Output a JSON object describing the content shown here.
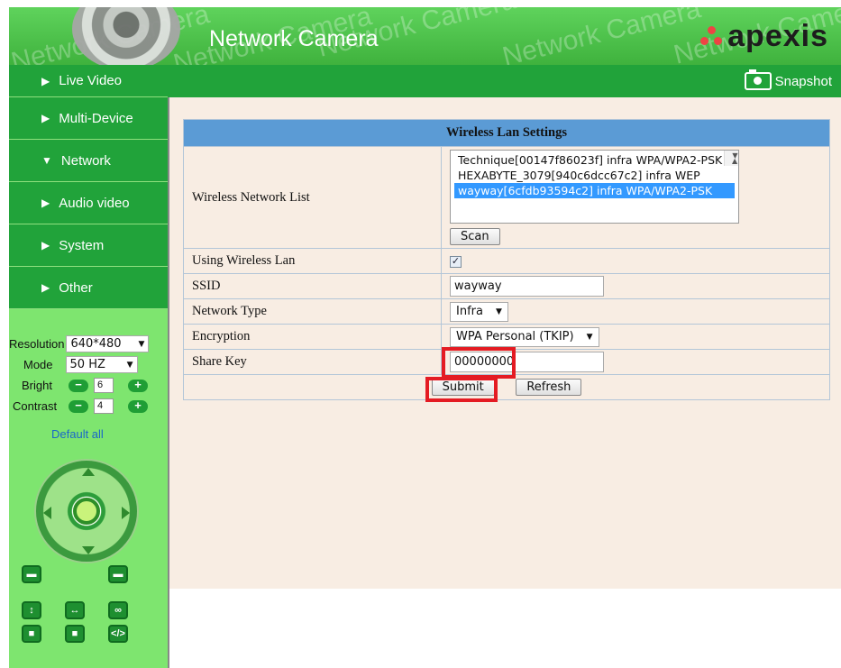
{
  "header": {
    "title": "Network Camera",
    "brand": "apexis",
    "watermark": "Network Camera"
  },
  "toolbar": {
    "snapshot_label": "Snapshot"
  },
  "sidebar": {
    "items": [
      {
        "label": "Live Video",
        "expanded": false
      },
      {
        "label": "Multi-Device",
        "expanded": false
      },
      {
        "label": "Network",
        "expanded": true
      },
      {
        "label": "Audio video",
        "expanded": false
      },
      {
        "label": "System",
        "expanded": false
      },
      {
        "label": "Other",
        "expanded": false
      }
    ],
    "controls": {
      "resolution_label": "Resolution",
      "resolution_value": "640*480",
      "mode_label": "Mode",
      "mode_value": "50 HZ",
      "bright_label": "Bright",
      "bright_value": "6",
      "contrast_label": "Contrast",
      "contrast_value": "4",
      "default_all": "Default all",
      "minus": "−",
      "plus": "+"
    },
    "icon_buttons": [
      {
        "glyph": "▬"
      },
      {
        "glyph": "▬"
      },
      {
        "glyph": "↕"
      },
      {
        "glyph": "↔"
      },
      {
        "glyph": "∞"
      },
      {
        "glyph": "■"
      },
      {
        "glyph": "■"
      },
      {
        "glyph": "</>"
      }
    ]
  },
  "wireless": {
    "title": "Wireless Lan Settings",
    "network_list_label": "Wireless Network List",
    "networks": [
      "Technique[00147f86023f] infra WPA/WPA2-PSK",
      "HEXABYTE_3079[940c6dcc67c2] infra WEP",
      "wayway[6cfdb93594c2] infra WPA/WPA2-PSK"
    ],
    "selected_network_index": 2,
    "scan_label": "Scan",
    "using_wireless_label": "Using Wireless Lan",
    "using_wireless_checked": true,
    "ssid_label": "SSID",
    "ssid_value": "wayway",
    "network_type_label": "Network Type",
    "network_type_value": "Infra",
    "encryption_label": "Encryption",
    "encryption_value": "WPA Personal (TKIP)",
    "share_key_label": "Share Key",
    "share_key_value": "00000000",
    "submit_label": "Submit",
    "refresh_label": "Refresh"
  },
  "colors": {
    "nav_green": "#21a33a",
    "sidebar_bg": "#7ee56f",
    "table_header": "#5b9bd5",
    "panel_bg": "#f8ede3",
    "highlight_red": "#e41b23"
  }
}
